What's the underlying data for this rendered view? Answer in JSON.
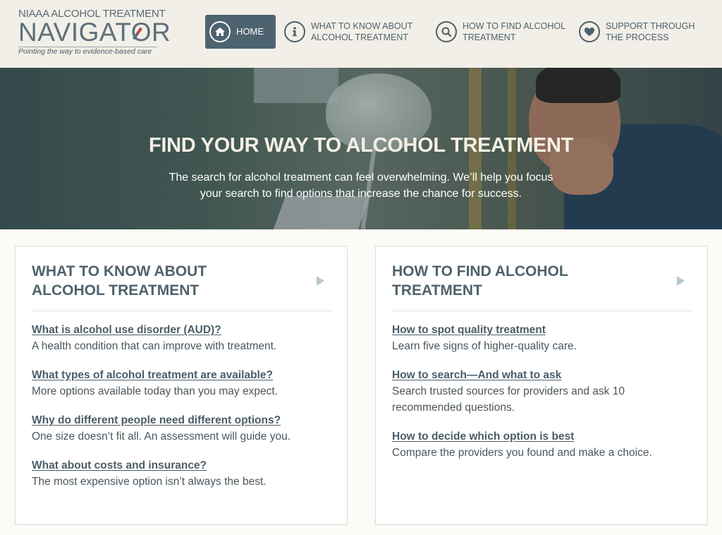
{
  "logo": {
    "top": "NIAAA ALCOHOL TREATMENT",
    "main": "NAVIGATOR",
    "tagline": "Pointing the way to evidence-based care"
  },
  "nav": {
    "home": "HOME",
    "know": "What to know about alcohol treatment",
    "find": "How to find alcohol treatment",
    "support": "Support through the process"
  },
  "hero": {
    "title": "FIND YOUR WAY TO ALCOHOL TREATMENT",
    "subtitle": "The search for alcohol treatment can feel overwhelming. We’ll help you focus your search to find options that increase the chance for success."
  },
  "cards": [
    {
      "title": "What to know about alcohol treatment",
      "items": [
        {
          "link": "What is alcohol use disorder (AUD)?",
          "desc": "A health condition that can improve with treatment."
        },
        {
          "link": "What types of alcohol treatment are available?",
          "desc": "More options available today than you may expect."
        },
        {
          "link": "Why do different people need different options?",
          "desc": "One size doesn’t fit all. An assessment will guide you."
        },
        {
          "link": "What about costs and insurance?",
          "desc": "The most expensive option isn’t always the best."
        }
      ]
    },
    {
      "title": "How to find alcohol treatment",
      "items": [
        {
          "link": "How to spot quality treatment",
          "desc": "Learn five signs of higher-quality care."
        },
        {
          "link": "How to search—And what to ask",
          "desc": "Search trusted sources for providers and ask 10 recommended questions."
        },
        {
          "link": "How to decide which option is best",
          "desc": "Compare the providers you found and make a choice."
        }
      ]
    }
  ],
  "colors": {
    "header_bg": "#f1efe8",
    "home_button": "#4e6370",
    "title_text": "#4f616c",
    "arrow": "#b7c8cf"
  },
  "icons": {
    "home": "house-icon",
    "know": "info-icon",
    "find": "magnifier-icon",
    "support": "heart-icon",
    "card_arrow": "triangle-right-icon"
  }
}
